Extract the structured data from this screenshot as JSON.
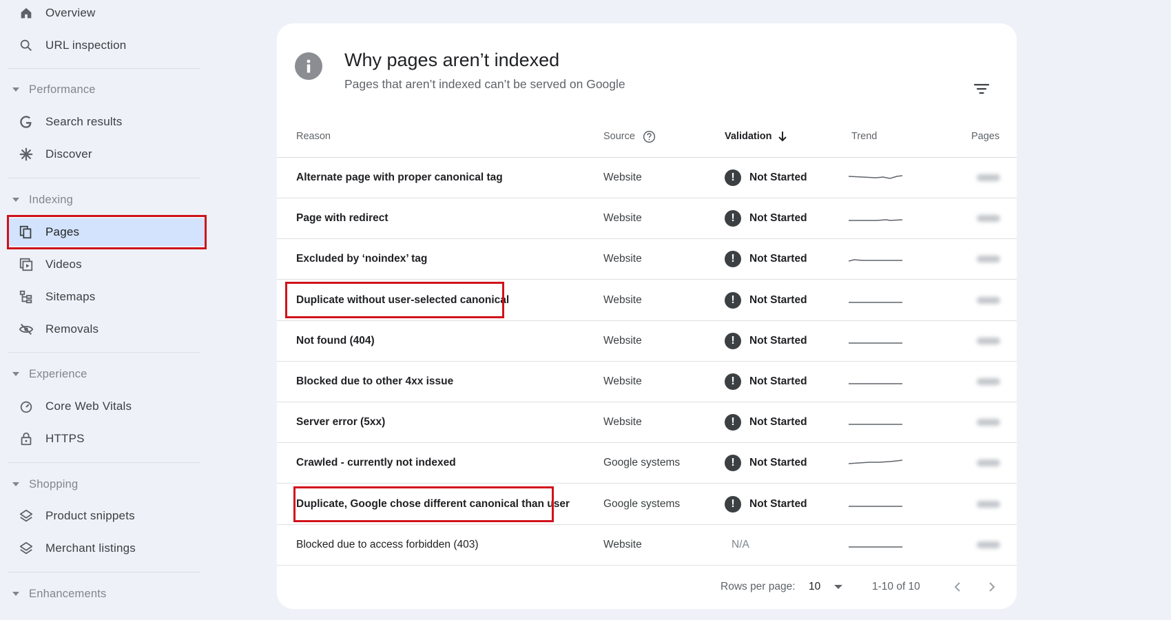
{
  "sidebar": {
    "overview": "Overview",
    "url_inspection": "URL inspection",
    "performance": "Performance",
    "search_results": "Search results",
    "discover": "Discover",
    "indexing": "Indexing",
    "pages": "Pages",
    "videos": "Videos",
    "sitemaps": "Sitemaps",
    "removals": "Removals",
    "experience": "Experience",
    "core_web_vitals": "Core Web Vitals",
    "https": "HTTPS",
    "shopping": "Shopping",
    "product_snippets": "Product snippets",
    "merchant_listings": "Merchant listings",
    "enhancements": "Enhancements"
  },
  "card": {
    "title": "Why pages aren’t indexed",
    "subtitle": "Pages that aren’t indexed can’t be served on Google",
    "columns": {
      "reason": "Reason",
      "source": "Source",
      "validation": "Validation",
      "trend": "Trend",
      "pages": "Pages"
    },
    "rows": [
      {
        "reason": "Alternate page with proper canonical tag",
        "source": "Website",
        "validation": "Not Started"
      },
      {
        "reason": "Page with redirect",
        "source": "Website",
        "validation": "Not Started"
      },
      {
        "reason": "Excluded by ‘noindex’ tag",
        "source": "Website",
        "validation": "Not Started"
      },
      {
        "reason": "Duplicate without user-selected canonical",
        "source": "Website",
        "validation": "Not Started"
      },
      {
        "reason": "Not found (404)",
        "source": "Website",
        "validation": "Not Started"
      },
      {
        "reason": "Blocked due to other 4xx issue",
        "source": "Website",
        "validation": "Not Started"
      },
      {
        "reason": "Server error (5xx)",
        "source": "Website",
        "validation": "Not Started"
      },
      {
        "reason": "Crawled - currently not indexed",
        "source": "Google systems",
        "validation": "Not Started"
      },
      {
        "reason": "Duplicate, Google chose different canonical than user",
        "source": "Google systems",
        "validation": "Not Started"
      },
      {
        "reason": "Blocked due to access forbidden (403)",
        "source": "Website",
        "validation": "N/A"
      }
    ],
    "footer": {
      "rows_per_page_label": "Rows per page:",
      "rows_per_page_value": "10",
      "range": "1-10 of 10"
    }
  },
  "colors": {
    "highlight": "#d0121b",
    "selected_nav": "#d3e3fd",
    "background": "#eef2f8"
  }
}
